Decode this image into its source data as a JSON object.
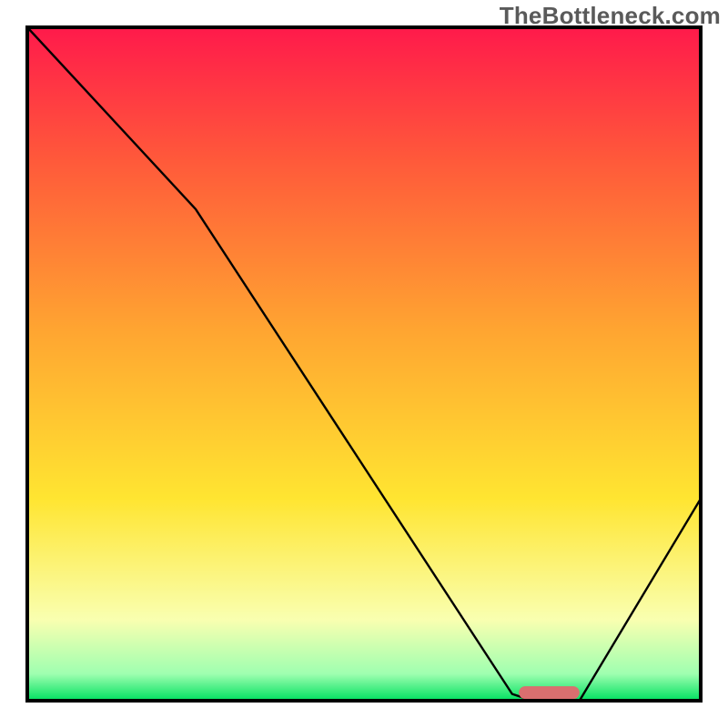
{
  "watermark": "TheBottleneck.com",
  "chart_data": {
    "type": "line",
    "title": "",
    "xlabel": "",
    "ylabel": "",
    "xlim": [
      0,
      100
    ],
    "ylim": [
      0,
      100
    ],
    "x": [
      0,
      25,
      72,
      75,
      82,
      100
    ],
    "values": [
      100,
      73,
      1,
      0,
      0,
      30
    ],
    "marker": {
      "x_start": 73,
      "x_end": 82,
      "y": 1.2,
      "color": "#d96f6f"
    },
    "gradient_stops": [
      {
        "offset": 0.0,
        "color": "#ff1a4b"
      },
      {
        "offset": 0.2,
        "color": "#ff5a3a"
      },
      {
        "offset": 0.45,
        "color": "#ffa531"
      },
      {
        "offset": 0.7,
        "color": "#ffe531"
      },
      {
        "offset": 0.88,
        "color": "#f9ffb0"
      },
      {
        "offset": 0.96,
        "color": "#9fffb0"
      },
      {
        "offset": 1.0,
        "color": "#00e060"
      }
    ],
    "frame_color": "#000000",
    "line_color": "#000000"
  }
}
